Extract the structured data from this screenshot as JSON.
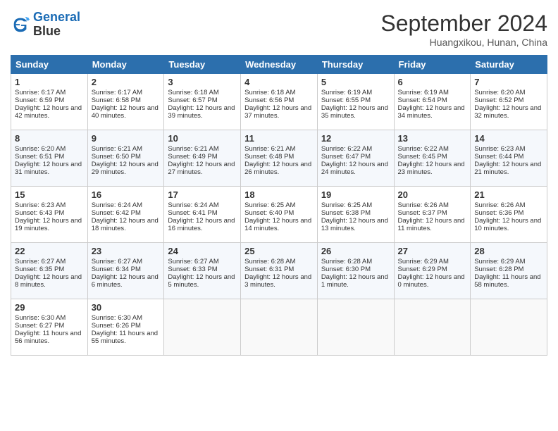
{
  "header": {
    "logo_line1": "General",
    "logo_line2": "Blue",
    "month_title": "September 2024",
    "subtitle": "Huangxikou, Hunan, China"
  },
  "days_of_week": [
    "Sunday",
    "Monday",
    "Tuesday",
    "Wednesday",
    "Thursday",
    "Friday",
    "Saturday"
  ],
  "weeks": [
    [
      {
        "day": "1",
        "sunrise": "Sunrise: 6:17 AM",
        "sunset": "Sunset: 6:59 PM",
        "daylight": "Daylight: 12 hours and 42 minutes."
      },
      {
        "day": "2",
        "sunrise": "Sunrise: 6:17 AM",
        "sunset": "Sunset: 6:58 PM",
        "daylight": "Daylight: 12 hours and 40 minutes."
      },
      {
        "day": "3",
        "sunrise": "Sunrise: 6:18 AM",
        "sunset": "Sunset: 6:57 PM",
        "daylight": "Daylight: 12 hours and 39 minutes."
      },
      {
        "day": "4",
        "sunrise": "Sunrise: 6:18 AM",
        "sunset": "Sunset: 6:56 PM",
        "daylight": "Daylight: 12 hours and 37 minutes."
      },
      {
        "day": "5",
        "sunrise": "Sunrise: 6:19 AM",
        "sunset": "Sunset: 6:55 PM",
        "daylight": "Daylight: 12 hours and 35 minutes."
      },
      {
        "day": "6",
        "sunrise": "Sunrise: 6:19 AM",
        "sunset": "Sunset: 6:54 PM",
        "daylight": "Daylight: 12 hours and 34 minutes."
      },
      {
        "day": "7",
        "sunrise": "Sunrise: 6:20 AM",
        "sunset": "Sunset: 6:52 PM",
        "daylight": "Daylight: 12 hours and 32 minutes."
      }
    ],
    [
      {
        "day": "8",
        "sunrise": "Sunrise: 6:20 AM",
        "sunset": "Sunset: 6:51 PM",
        "daylight": "Daylight: 12 hours and 31 minutes."
      },
      {
        "day": "9",
        "sunrise": "Sunrise: 6:21 AM",
        "sunset": "Sunset: 6:50 PM",
        "daylight": "Daylight: 12 hours and 29 minutes."
      },
      {
        "day": "10",
        "sunrise": "Sunrise: 6:21 AM",
        "sunset": "Sunset: 6:49 PM",
        "daylight": "Daylight: 12 hours and 27 minutes."
      },
      {
        "day": "11",
        "sunrise": "Sunrise: 6:21 AM",
        "sunset": "Sunset: 6:48 PM",
        "daylight": "Daylight: 12 hours and 26 minutes."
      },
      {
        "day": "12",
        "sunrise": "Sunrise: 6:22 AM",
        "sunset": "Sunset: 6:47 PM",
        "daylight": "Daylight: 12 hours and 24 minutes."
      },
      {
        "day": "13",
        "sunrise": "Sunrise: 6:22 AM",
        "sunset": "Sunset: 6:45 PM",
        "daylight": "Daylight: 12 hours and 23 minutes."
      },
      {
        "day": "14",
        "sunrise": "Sunrise: 6:23 AM",
        "sunset": "Sunset: 6:44 PM",
        "daylight": "Daylight: 12 hours and 21 minutes."
      }
    ],
    [
      {
        "day": "15",
        "sunrise": "Sunrise: 6:23 AM",
        "sunset": "Sunset: 6:43 PM",
        "daylight": "Daylight: 12 hours and 19 minutes."
      },
      {
        "day": "16",
        "sunrise": "Sunrise: 6:24 AM",
        "sunset": "Sunset: 6:42 PM",
        "daylight": "Daylight: 12 hours and 18 minutes."
      },
      {
        "day": "17",
        "sunrise": "Sunrise: 6:24 AM",
        "sunset": "Sunset: 6:41 PM",
        "daylight": "Daylight: 12 hours and 16 minutes."
      },
      {
        "day": "18",
        "sunrise": "Sunrise: 6:25 AM",
        "sunset": "Sunset: 6:40 PM",
        "daylight": "Daylight: 12 hours and 14 minutes."
      },
      {
        "day": "19",
        "sunrise": "Sunrise: 6:25 AM",
        "sunset": "Sunset: 6:38 PM",
        "daylight": "Daylight: 12 hours and 13 minutes."
      },
      {
        "day": "20",
        "sunrise": "Sunrise: 6:26 AM",
        "sunset": "Sunset: 6:37 PM",
        "daylight": "Daylight: 12 hours and 11 minutes."
      },
      {
        "day": "21",
        "sunrise": "Sunrise: 6:26 AM",
        "sunset": "Sunset: 6:36 PM",
        "daylight": "Daylight: 12 hours and 10 minutes."
      }
    ],
    [
      {
        "day": "22",
        "sunrise": "Sunrise: 6:27 AM",
        "sunset": "Sunset: 6:35 PM",
        "daylight": "Daylight: 12 hours and 8 minutes."
      },
      {
        "day": "23",
        "sunrise": "Sunrise: 6:27 AM",
        "sunset": "Sunset: 6:34 PM",
        "daylight": "Daylight: 12 hours and 6 minutes."
      },
      {
        "day": "24",
        "sunrise": "Sunrise: 6:27 AM",
        "sunset": "Sunset: 6:33 PM",
        "daylight": "Daylight: 12 hours and 5 minutes."
      },
      {
        "day": "25",
        "sunrise": "Sunrise: 6:28 AM",
        "sunset": "Sunset: 6:31 PM",
        "daylight": "Daylight: 12 hours and 3 minutes."
      },
      {
        "day": "26",
        "sunrise": "Sunrise: 6:28 AM",
        "sunset": "Sunset: 6:30 PM",
        "daylight": "Daylight: 12 hours and 1 minute."
      },
      {
        "day": "27",
        "sunrise": "Sunrise: 6:29 AM",
        "sunset": "Sunset: 6:29 PM",
        "daylight": "Daylight: 12 hours and 0 minutes."
      },
      {
        "day": "28",
        "sunrise": "Sunrise: 6:29 AM",
        "sunset": "Sunset: 6:28 PM",
        "daylight": "Daylight: 11 hours and 58 minutes."
      }
    ],
    [
      {
        "day": "29",
        "sunrise": "Sunrise: 6:30 AM",
        "sunset": "Sunset: 6:27 PM",
        "daylight": "Daylight: 11 hours and 56 minutes."
      },
      {
        "day": "30",
        "sunrise": "Sunrise: 6:30 AM",
        "sunset": "Sunset: 6:26 PM",
        "daylight": "Daylight: 11 hours and 55 minutes."
      },
      {
        "day": "",
        "sunrise": "",
        "sunset": "",
        "daylight": ""
      },
      {
        "day": "",
        "sunrise": "",
        "sunset": "",
        "daylight": ""
      },
      {
        "day": "",
        "sunrise": "",
        "sunset": "",
        "daylight": ""
      },
      {
        "day": "",
        "sunrise": "",
        "sunset": "",
        "daylight": ""
      },
      {
        "day": "",
        "sunrise": "",
        "sunset": "",
        "daylight": ""
      }
    ]
  ]
}
